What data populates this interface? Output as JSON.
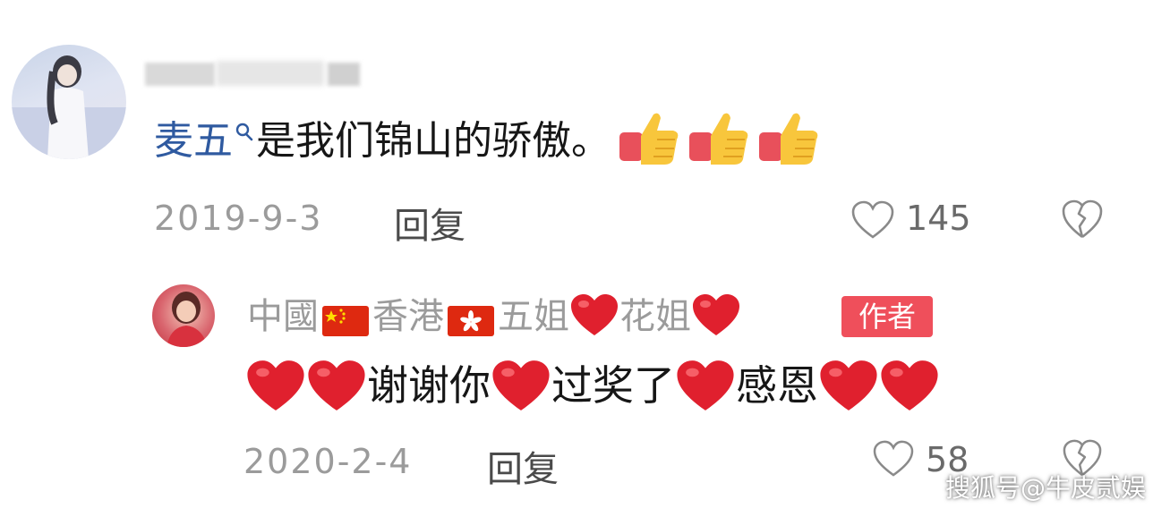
{
  "comment": {
    "mention": "麦五",
    "text": "是我们锦山的骄傲。",
    "date": "2019-9-3",
    "reply_label": "回复",
    "like_count": "145",
    "emoji_count": 3
  },
  "reply": {
    "name_parts": [
      "中國",
      "香港",
      "五姐",
      "花姐"
    ],
    "author_badge": "作者",
    "text_parts": [
      "谢谢你",
      "过奖了",
      "感恩"
    ],
    "date": "2020-2-4",
    "reply_label": "回复",
    "like_count": "58"
  },
  "watermark": "搜狐号@牛皮贰娱",
  "icons": {
    "like": "heart-outline-icon",
    "dislike": "broken-heart-icon",
    "search": "search-icon",
    "thumbs": "thumbs-up-icon",
    "heart": "red-heart-icon"
  },
  "colors": {
    "mention": "#2f5aa0",
    "meta": "#9b9b9b",
    "badge": "#ef4f5b",
    "heart": "#e0202e"
  }
}
